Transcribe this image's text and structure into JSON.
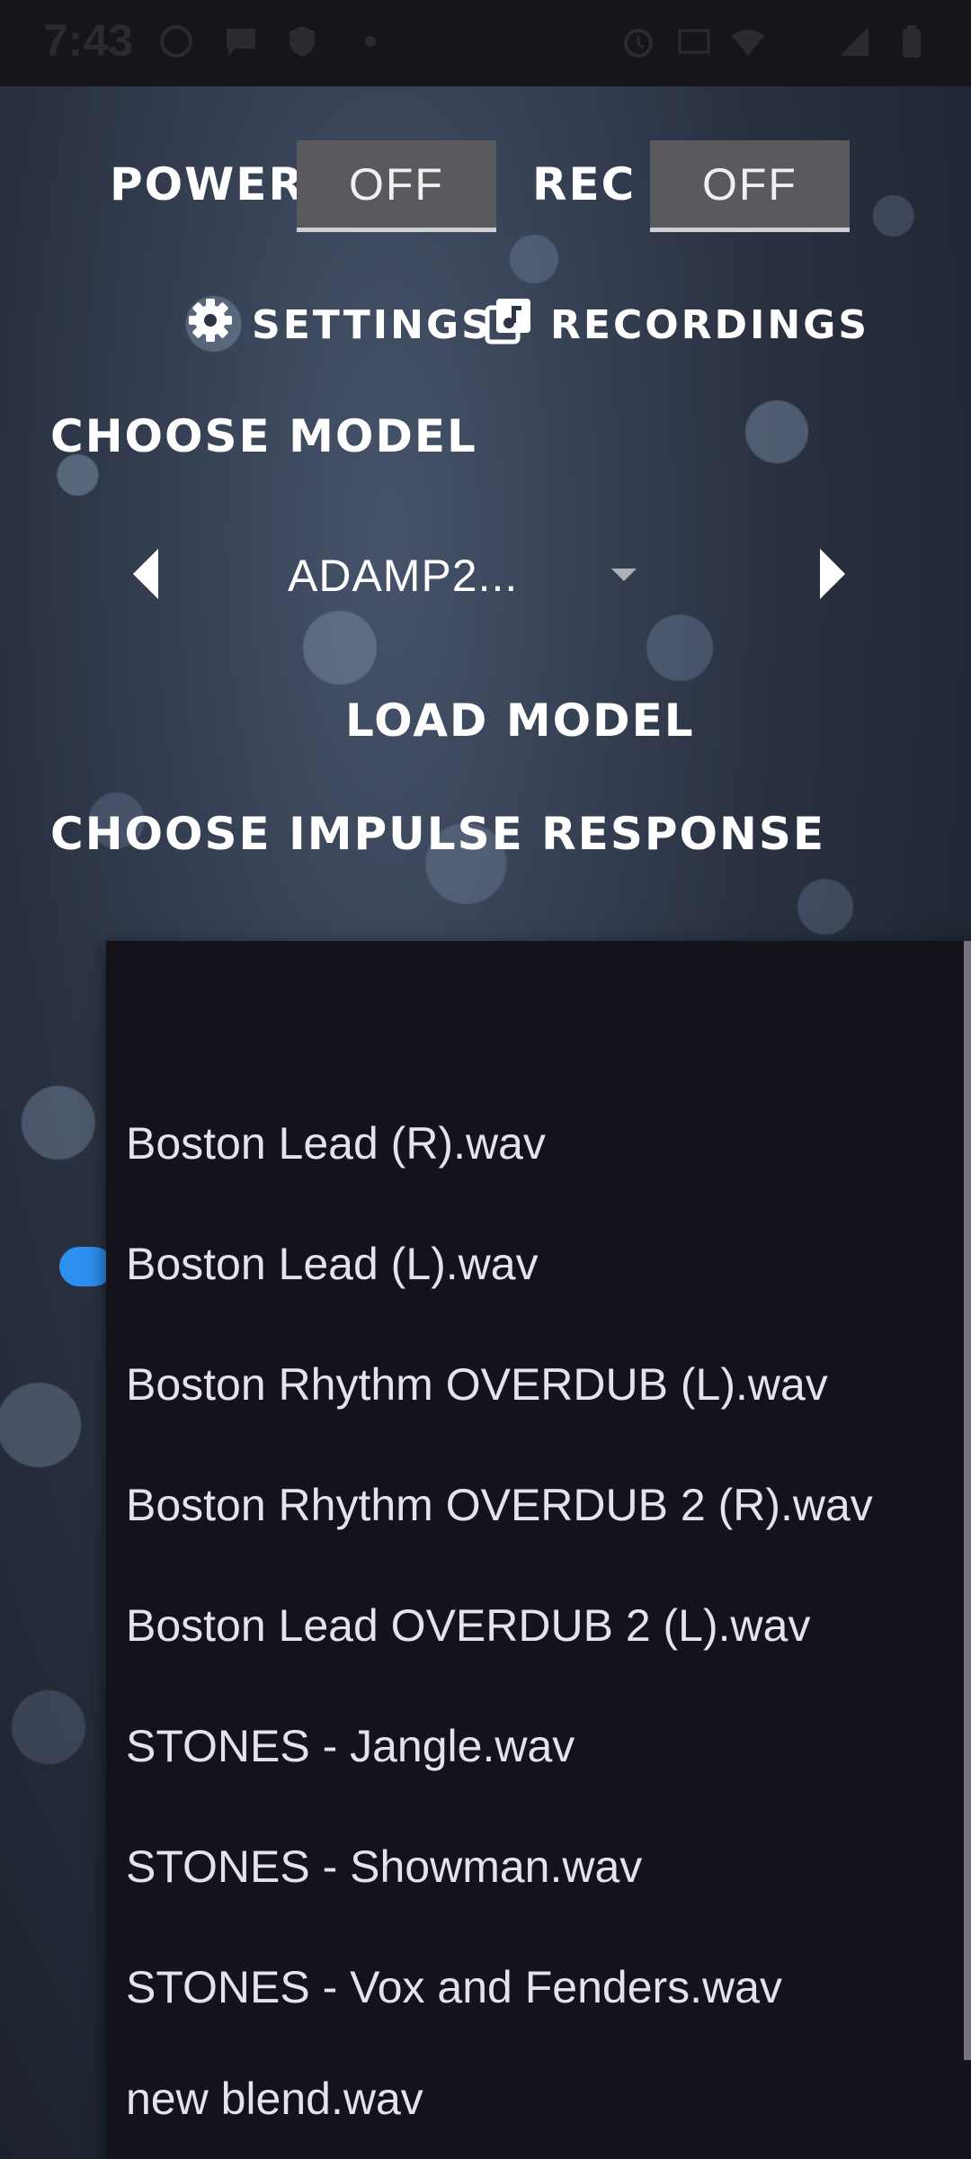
{
  "status_bar": {
    "time": "7:43",
    "icons": [
      "whatsapp-icon",
      "chat-icon",
      "shield-icon",
      "dot-icon",
      "alarm-icon",
      "volte-icon",
      "wifi-icon",
      "signal-icon",
      "battery-icon"
    ]
  },
  "controls": {
    "power_label": "POWER",
    "power_value": "OFF",
    "rec_label": "REC",
    "rec_value": "OFF"
  },
  "nav": {
    "settings_label": "SETTINGS",
    "recordings_label": "RECORDINGS"
  },
  "model": {
    "heading": "CHOOSE MODEL",
    "selected": "ADAMP2...",
    "load_button": "LOAD MODEL"
  },
  "impulse": {
    "heading": "CHOOSE IMPULSE RESPONSE"
  },
  "dropdown": {
    "items": [
      "",
      "Boston Lead (R).wav",
      "Boston Lead (L).wav",
      "Boston Rhythm OVERDUB (L).wav",
      "Boston Rhythm OVERDUB 2 (R).wav",
      "Boston Lead OVERDUB 2 (L).wav",
      "STONES - Jangle.wav",
      "STONES - Showman.wav",
      "STONES - Vox and Fenders.wav",
      "new blend.wav"
    ]
  },
  "colors": {
    "accent_blue": "#2d8ff0",
    "dropdown_bg": "#14121a",
    "toggle_bg": "#5a5a5e"
  }
}
